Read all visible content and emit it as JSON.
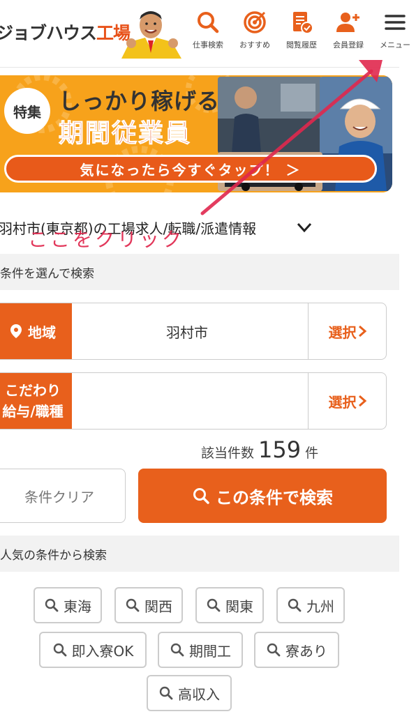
{
  "header": {
    "logo_text": "ジョブハウス",
    "logo_accent": "工場",
    "nav": [
      {
        "label": "仕事検索",
        "icon": "search-icon"
      },
      {
        "label": "おすすめ",
        "icon": "target-icon"
      },
      {
        "label": "閲覧履歴",
        "icon": "history-doc-icon"
      },
      {
        "label": "会員登録",
        "icon": "add-user-icon"
      },
      {
        "label": "メニュー",
        "icon": "hamburger-menu-icon"
      }
    ]
  },
  "banner": {
    "badge": "特集",
    "line1": "しっかり稼げる",
    "line2": "期間従業員",
    "cta": "気になったら今すぐタップ！ ＞"
  },
  "page_title": "羽村市(東京都)の工場求人/転職/派遣情報",
  "annotation": "ここをクリック",
  "search": {
    "subhead": "条件を選んで検索",
    "area_tag": "地域",
    "area_value": "羽村市",
    "area_select": "選択",
    "pref_tag_line1": "こだわり",
    "pref_tag_line2": "給与/職種",
    "pref_value": "",
    "pref_select": "選択",
    "count_label": "該当件数",
    "count": "159",
    "count_unit": "件",
    "clear_label": "条件クリア",
    "search_label": "この条件で検索"
  },
  "popular": {
    "subhead": "人気の条件から検索",
    "chips": [
      "東海",
      "関西",
      "関東",
      "九州",
      "即入寮OK",
      "期間工",
      "寮あり",
      "高収入"
    ]
  },
  "colors": {
    "accent": "#e8601c",
    "annotation": "#e0284e"
  }
}
